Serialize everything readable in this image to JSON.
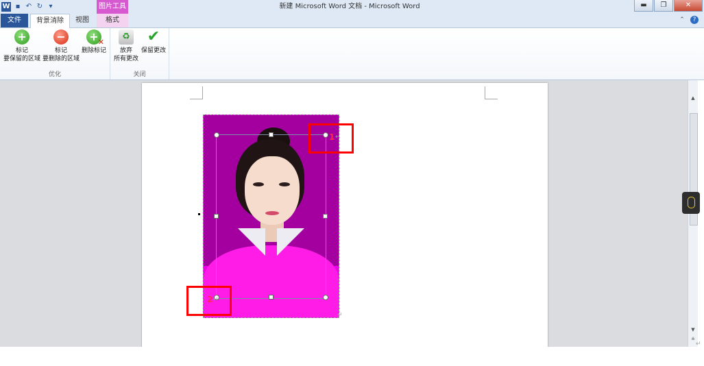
{
  "window": {
    "title": "新建 Microsoft Word 文档 - Microsoft Word",
    "context_tab_title": "图片工具",
    "buttons": {
      "minimize": "▬",
      "restore": "❐",
      "close": "✕"
    }
  },
  "quick_access": {
    "app_icon": "W",
    "save_icon": "▪",
    "undo_icon": "↶",
    "redo_icon": "↻",
    "more_icon": "▾"
  },
  "tabs": [
    "文件",
    "背景消除",
    "视图",
    "格式"
  ],
  "help": {
    "collapse_icon": "⌃",
    "help_icon": "?"
  },
  "ribbon": {
    "groups": [
      {
        "label": "优化",
        "buttons": [
          {
            "icon": "+",
            "line1": "标记",
            "line2": "要保留的区域"
          },
          {
            "icon": "−",
            "line1": "标记",
            "line2": "要删除的区域"
          },
          {
            "icon": "+",
            "line1": "删除标记",
            "line2": ""
          }
        ]
      },
      {
        "label": "关闭",
        "buttons": [
          {
            "icon": "♻",
            "line1": "放弃",
            "line2": "所有更改"
          },
          {
            "icon": "✔",
            "line1": "保留更改",
            "line2": ""
          }
        ]
      }
    ]
  },
  "document": {
    "annotations": [
      {
        "label": "1",
        "return_mark": "↵"
      },
      {
        "label": "2",
        "return_mark": "↵"
      }
    ],
    "photo_return_mark": "↵",
    "page_return_mark": "↵"
  },
  "scrollbar": {
    "up": "▲",
    "down": "▼",
    "prev_page": "±"
  }
}
